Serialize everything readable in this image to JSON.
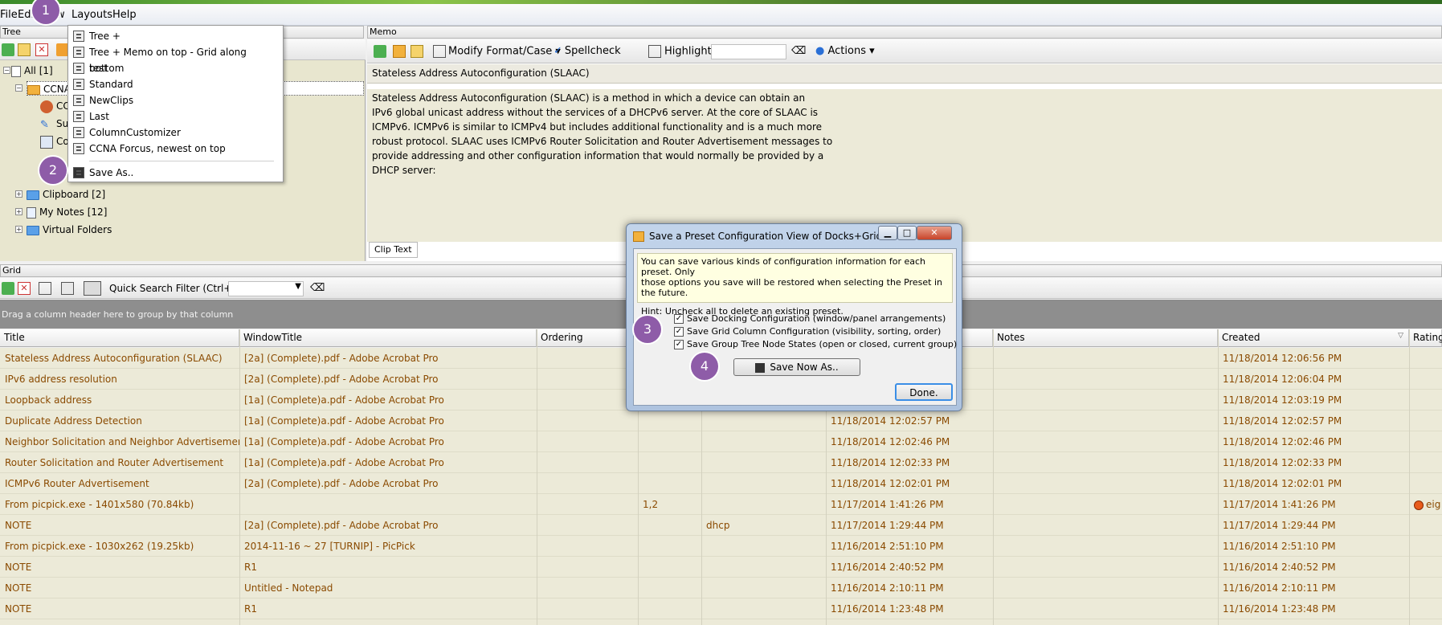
{
  "menubar": {
    "file": "File",
    "edit": "Edi",
    "view": "w",
    "layouts": "Layouts",
    "help": "Help"
  },
  "panels": {
    "tree_title": "Tree",
    "memo_title": "Memo",
    "grid_title": "Grid"
  },
  "tree": {
    "all": "All [1]",
    "ccna": "CCNA",
    "children": [
      "CC",
      "Su",
      "Co"
    ],
    "clipboard": "Clipboard [2]",
    "my_notes": "My Notes [12]",
    "virtual_folders": "Virtual Folders"
  },
  "layouts_menu": {
    "items": [
      "Tree +",
      "Tree + Memo on top - Grid along bottom",
      "test",
      "Standard",
      "NewClips",
      "Last",
      "ColumnCustomizer",
      "CCNA Forcus, newest on top"
    ],
    "save_as": "Save As.."
  },
  "memo": {
    "modify_format": "Modify Format/Case",
    "spellcheck": "Spellcheck",
    "highlight": "Highlight",
    "actions": "Actions",
    "title": "Stateless Address Autoconfiguration (SLAAC)",
    "body_lines": [
      "Stateless Address Autoconfiguration (SLAAC) is a method in which a device can obtain an",
      "IPv6 global unicast address without the services of a DHCPv6 server. At the core of SLAAC is",
      "ICMPv6. ICMPv6 is similar to ICMPv4 but includes additional functionality and is a much more",
      "robust protocol. SLAAC uses ICMPv6 Router Solicitation and Router Advertisement messages to",
      "provide addressing and other configuration information that would normally be provided by a",
      "DHCP server:"
    ],
    "tab": "Clip Text"
  },
  "grid": {
    "search_label": "Quick Search Filter (Ctrl+F):",
    "group_hint": "Drag a column header here to group by that column",
    "columns": [
      "Title",
      "WindowTitle",
      "Ordering",
      "Notes",
      "Created",
      "Rating"
    ],
    "rows": [
      {
        "title": "Stateless Address Autoconfiguration (SLAAC)",
        "window": "[2a] (Complete).pdf - Adobe Acrobat Pro",
        "ordering": "",
        "tag": "",
        "date": "",
        "created": "11/18/2014 12:06:56 PM",
        "rating": ""
      },
      {
        "title": "IPv6 address resolution",
        "window": "[2a] (Complete).pdf - Adobe Acrobat Pro",
        "ordering": "",
        "tag": "",
        "date": "",
        "created": "11/18/2014 12:06:04 PM",
        "rating": ""
      },
      {
        "title": "Loopback address",
        "window": "[1a] (Complete)a.pdf - Adobe Acrobat Pro",
        "ordering": "",
        "tag": "",
        "date": "",
        "created": "11/18/2014 12:03:19 PM",
        "rating": ""
      },
      {
        "title": "Duplicate Address Detection",
        "window": "[1a] (Complete)a.pdf - Adobe Acrobat Pro",
        "ordering": "",
        "tag": "",
        "date": "11/18/2014 12:02:57 PM",
        "created": "11/18/2014 12:02:57 PM",
        "rating": ""
      },
      {
        "title": "Neighbor Solicitation and Neighbor Advertisement",
        "window": "[1a] (Complete)a.pdf - Adobe Acrobat Pro",
        "ordering": "",
        "tag": "",
        "date": "11/18/2014 12:02:46 PM",
        "created": "11/18/2014 12:02:46 PM",
        "rating": ""
      },
      {
        "title": "Router Solicitation and Router Advertisement",
        "window": "[1a] (Complete)a.pdf - Adobe Acrobat Pro",
        "ordering": "",
        "tag": "",
        "date": "11/18/2014 12:02:33 PM",
        "created": "11/18/2014 12:02:33 PM",
        "rating": ""
      },
      {
        "title": "ICMPv6 Router Advertisement",
        "window": "[2a] (Complete).pdf - Adobe Acrobat Pro",
        "ordering": "",
        "tag": "",
        "date": "11/18/2014 12:02:01 PM",
        "created": "11/18/2014 12:02:01 PM",
        "rating": ""
      },
      {
        "title": "From picpick.exe - 1401x580  (70.84kb)",
        "window": "",
        "ordering": "1,2",
        "tag": "",
        "date": "11/17/2014 1:41:26 PM",
        "created": "11/17/2014 1:41:26 PM",
        "rating": "eig"
      },
      {
        "title": "NOTE",
        "window": "[2a] (Complete).pdf - Adobe Acrobat Pro",
        "ordering": "",
        "tag": "dhcp",
        "date": "11/17/2014 1:29:44 PM",
        "created": "11/17/2014 1:29:44 PM",
        "rating": ""
      },
      {
        "title": "From picpick.exe - 1030x262  (19.25kb)",
        "window": "2014-11-16 ~ 27 [TURNIP] - PicPick",
        "ordering": "",
        "tag": "",
        "date": "11/16/2014 2:51:10 PM",
        "created": "11/16/2014 2:51:10 PM",
        "rating": ""
      },
      {
        "title": "NOTE",
        "window": "R1",
        "ordering": "",
        "tag": "",
        "date": "11/16/2014 2:40:52 PM",
        "created": "11/16/2014 2:40:52 PM",
        "rating": ""
      },
      {
        "title": "NOTE",
        "window": "Untitled - Notepad",
        "ordering": "",
        "tag": "",
        "date": "11/16/2014 2:10:11 PM",
        "created": "11/16/2014 2:10:11 PM",
        "rating": ""
      },
      {
        "title": "NOTE",
        "window": "R1",
        "ordering": "",
        "tag": "",
        "date": "11/16/2014 1:23:48 PM",
        "created": "11/16/2014 1:23:48 PM",
        "rating": ""
      }
    ]
  },
  "dialog": {
    "title": "Save a Preset Configuration View of Docks+Grid C...",
    "info_line1": "You can save various kinds of configuration information for each preset.  Only",
    "info_line2": "those options you save will be restored when selecting the Preset in the future.",
    "hint": "Hint: Uncheck all to delete an existing preset.",
    "checkboxes": [
      "Save Docking Configuration (window/panel arrangements)",
      "Save Grid Column Configuration (visibility, sorting, order)",
      "Save Group Tree Node States (open or closed, current group)"
    ],
    "save_now": "Save Now As..",
    "done": "Done."
  },
  "badges": [
    "1",
    "2",
    "3",
    "4"
  ],
  "colors": {
    "badge": "#8e5ca8",
    "grid_text": "#8a4a00",
    "grid_bg": "#ecead8"
  }
}
